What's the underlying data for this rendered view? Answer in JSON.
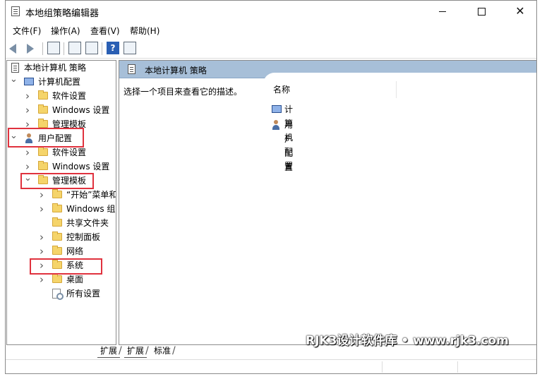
{
  "window": {
    "title": "本地组策略编辑器"
  },
  "menu": [
    "文件(F)",
    "操作(A)",
    "查看(V)",
    "帮助(H)"
  ],
  "toolbar": {
    "icons": [
      "back-arrow-icon",
      "forward-arrow-icon",
      "show-hide-tree-icon",
      "properties-icon",
      "export-list-icon",
      "help-icon",
      "show-hide-action-pane-icon"
    ],
    "help_glyph": "?"
  },
  "tree": {
    "root": "本地计算机 策略",
    "computer_config": "计算机配置",
    "computer_children": [
      "软件设置",
      "Windows 设置",
      "管理模板"
    ],
    "user_config": "用户配置",
    "user_children": [
      "软件设置",
      "Windows 设置",
      "管理模板"
    ],
    "admin_templates_children": [
      "“开始”菜单和",
      "Windows 组",
      "共享文件夹",
      "控制面板",
      "网络",
      "系统",
      "桌面",
      "所有设置"
    ]
  },
  "right_pane": {
    "header": "本地计算机 策略",
    "description": "选择一个项目来查看它的描述。",
    "column_name": "名称",
    "items": [
      "计算机配置",
      "用户配置"
    ]
  },
  "tabs": [
    "扩展",
    "扩展",
    "标准"
  ],
  "watermark": "RJK3设计软件库 • www.rjk3.com",
  "highlight_color": "#e0323e",
  "header_color": "#a7bfd8"
}
